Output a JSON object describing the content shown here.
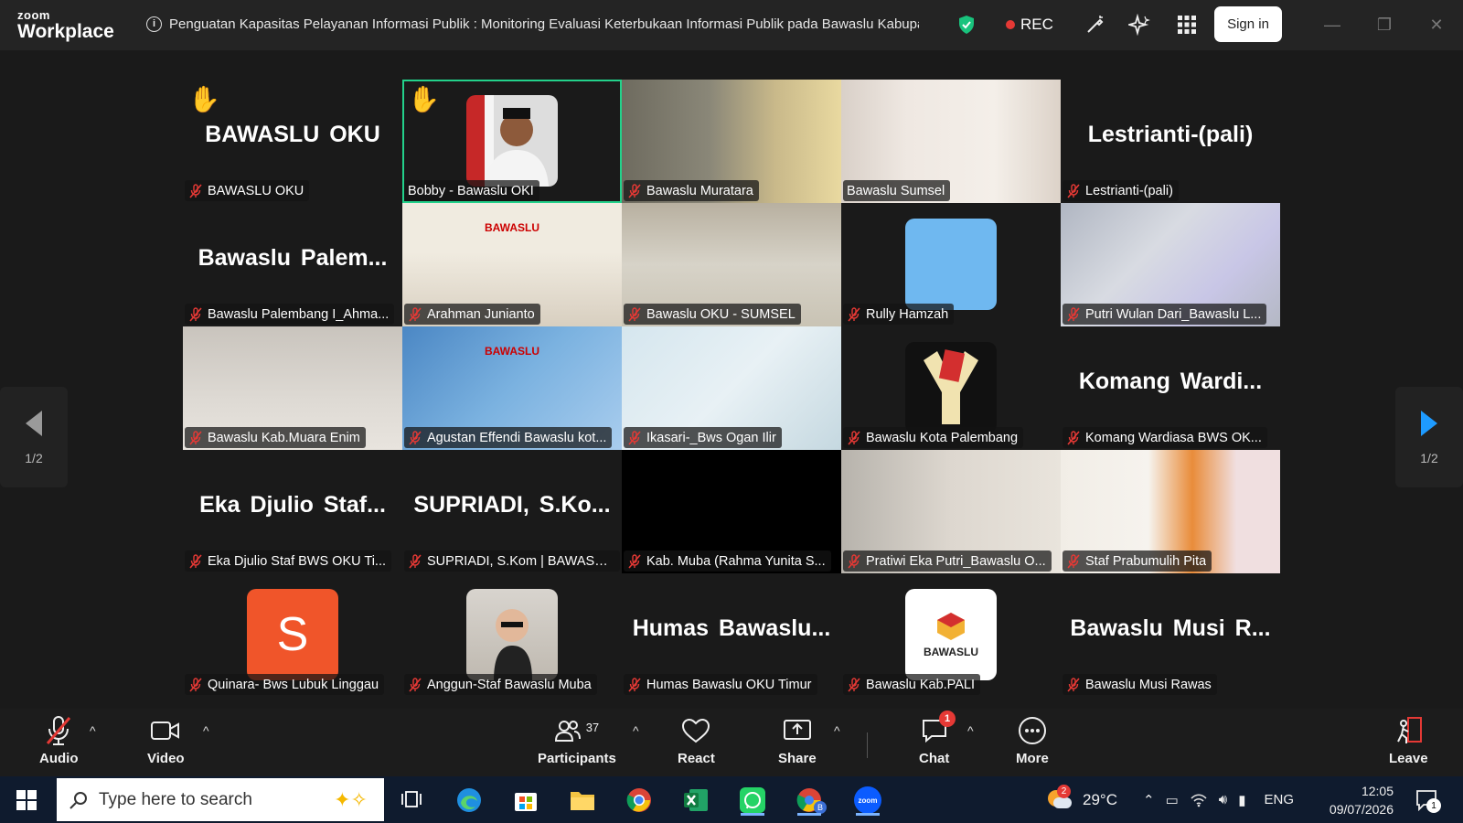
{
  "window": {
    "brand_top": "zoom",
    "brand_bottom": "Workplace",
    "meeting_title": "Penguatan Kapasitas Pelayanan Informasi Publik : Monitoring Evaluasi Keterbukaan Informasi Publik pada Bawaslu Kabupaten",
    "rec_label": "REC",
    "sign_in": "Sign in",
    "accent_green": "#23d18b",
    "rec_red": "#e53935"
  },
  "pager": {
    "left_page": "1/2",
    "right_page": "1/2"
  },
  "tiles": [
    {
      "label": "BAWASLU OKU",
      "big": "BAWASLU OKU",
      "hand": true
    },
    {
      "label": "Bobby - Bawaslu OKI",
      "hand": true,
      "active": true,
      "muted": false
    },
    {
      "label": "Bawaslu Muratara"
    },
    {
      "label": "Bawaslu Sumsel",
      "muted": false
    },
    {
      "label": "Lestrianti-(pali)",
      "big": "Lestrianti-(pali)"
    },
    {
      "label": "Bawaslu Palembang I_Ahma...",
      "big": "Bawaslu Palem..."
    },
    {
      "label": "Arahman Junianto",
      "banner": "BAWASLU"
    },
    {
      "label": "Bawaslu OKU - SUMSEL"
    },
    {
      "label": "Rully Hamzah"
    },
    {
      "label": "Putri Wulan Dari_Bawaslu L..."
    },
    {
      "label": "Bawaslu Kab.Muara Enim"
    },
    {
      "label": "Agustan Effendi Bawaslu kot...",
      "banner": "BAWASLU"
    },
    {
      "label": "Ikasari-_Bws Ogan Ilir"
    },
    {
      "label": "Bawaslu Kota Palembang"
    },
    {
      "label": "Komang Wardiasa BWS OK...",
      "big": "Komang Wardi..."
    },
    {
      "label": "Eka Djulio Staf BWS OKU Ti...",
      "big": "Eka Djulio Staf..."
    },
    {
      "label": "SUPRIADI, S.Kom | BAWASLU...",
      "big": "SUPRIADI, S.Ko..."
    },
    {
      "label": "Kab. Muba (Rahma Yunita S..."
    },
    {
      "label": "Pratiwi Eka Putri_Bawaslu O..."
    },
    {
      "label": "Staf Prabumulih Pita"
    },
    {
      "label": "Quinara- Bws Lubuk Linggau",
      "avatar_letter": "S"
    },
    {
      "label": "Anggun-Staf Bawaslu Muba"
    },
    {
      "label": "Humas Bawaslu OKU Timur",
      "big": "Humas Bawaslu..."
    },
    {
      "label": "Bawaslu Kab.PALI",
      "logo_text": "BAWASLU"
    },
    {
      "label": "Bawaslu Musi Rawas",
      "big": "Bawaslu Musi R..."
    }
  ],
  "toolbar": {
    "audio": "Audio",
    "video": "Video",
    "participants": "Participants",
    "participants_count": "37",
    "react": "React",
    "share": "Share",
    "chat": "Chat",
    "chat_badge": "1",
    "more": "More",
    "leave": "Leave"
  },
  "taskbar": {
    "search_placeholder": "Type here to search",
    "weather": "29°C",
    "weather_badge": "2",
    "language": "ENG",
    "time": "12:05",
    "date": "09/07/2026",
    "notif_badge": "1",
    "chrome_profile": "B"
  }
}
